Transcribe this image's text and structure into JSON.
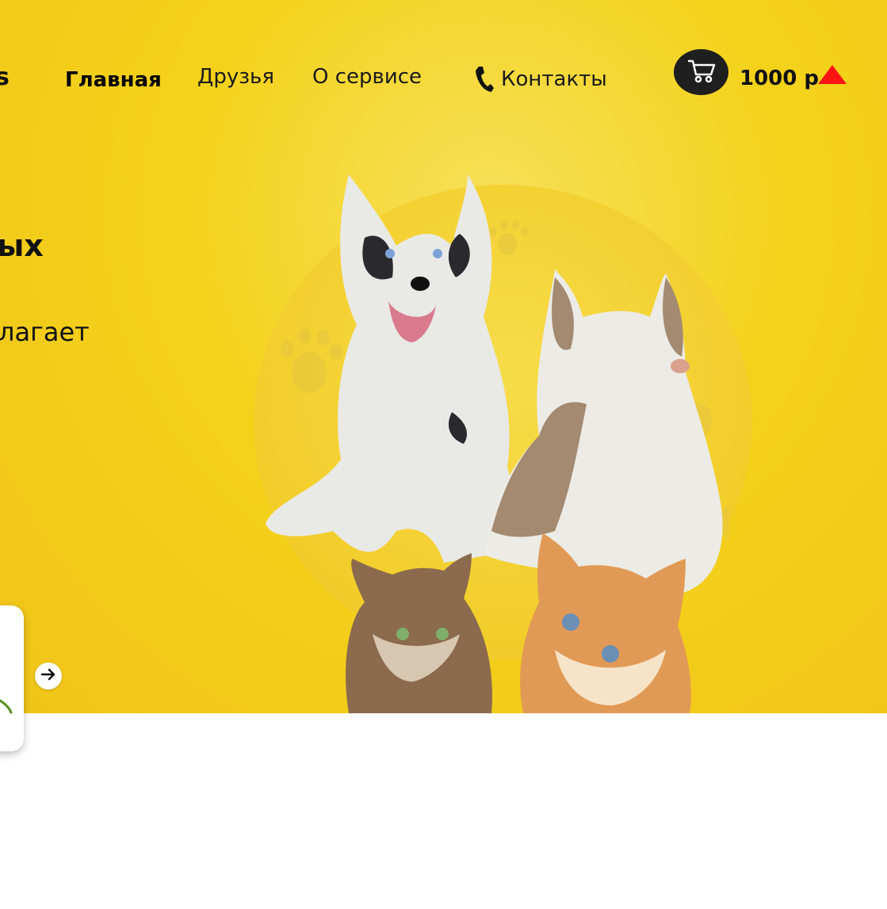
{
  "nav": {
    "logo_fragment": "s",
    "items": [
      {
        "label": "Главная"
      },
      {
        "label": "Друзья"
      },
      {
        "label": "О сервисе"
      },
      {
        "label": "Контакты"
      }
    ]
  },
  "header": {
    "balance": "1000 р",
    "icons": {
      "cart": "cart-icon",
      "phone": "phone-icon",
      "balance_arrow": "triangle-up-icon"
    }
  },
  "hero": {
    "title_fragment": "ых",
    "subtitle_fragment": "лагает",
    "next_icon": "arrow-right-icon"
  },
  "colors": {
    "hero_background": "#f4d21a",
    "accent_red": "#ff1414",
    "cart_button": "#1f1f1f"
  }
}
